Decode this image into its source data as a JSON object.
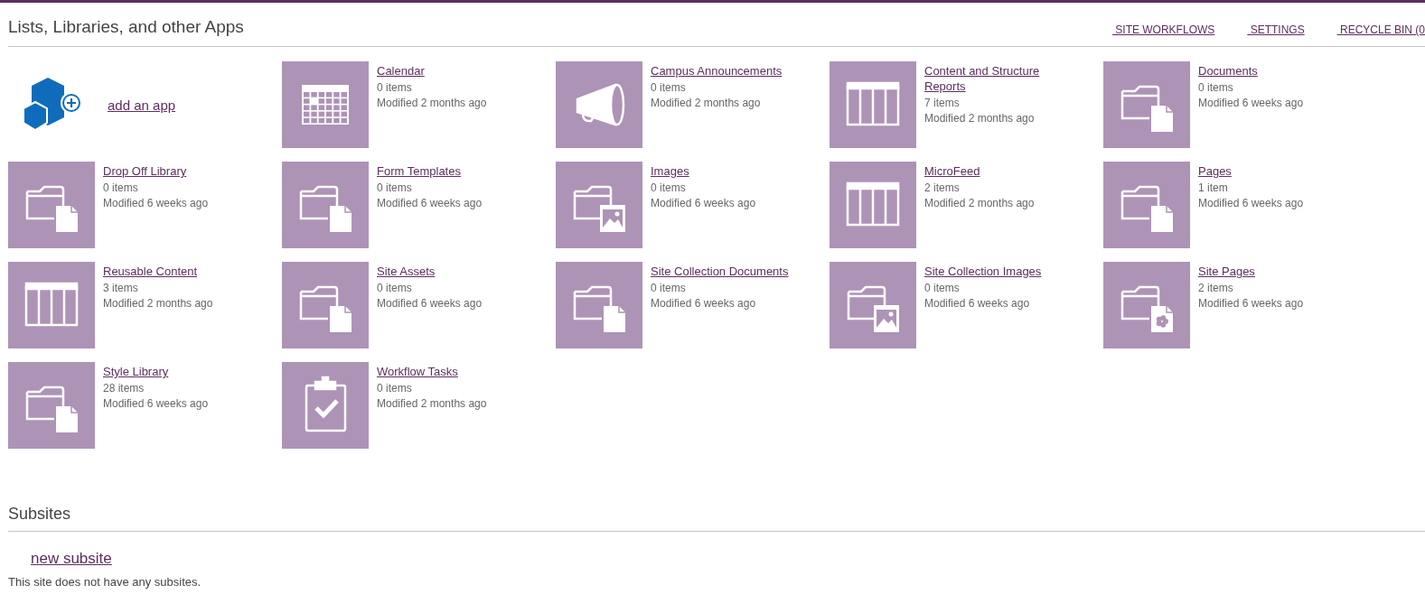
{
  "header": {
    "title": "Lists, Libraries, and other Apps",
    "links": [
      " SITE WORKFLOWS",
      " SETTINGS",
      " RECYCLE BIN (0"
    ]
  },
  "add_app": {
    "label": "add an app"
  },
  "apps": [
    {
      "kind": "calendar",
      "title": "Calendar",
      "count": "0 items",
      "modified": "Modified 2 months ago"
    },
    {
      "kind": "megaphone",
      "title": "Campus Announcements",
      "count": "0 items",
      "modified": "Modified 2 months ago"
    },
    {
      "kind": "table",
      "title": "Content and Structure Reports",
      "count": "7 items",
      "modified": "Modified 2 months ago"
    },
    {
      "kind": "document",
      "title": "Documents",
      "count": "0 items",
      "modified": "Modified 6 weeks ago"
    },
    {
      "kind": "document",
      "title": "Drop Off Library",
      "count": "0 items",
      "modified": "Modified 6 weeks ago"
    },
    {
      "kind": "document",
      "title": "Form Templates",
      "count": "0 items",
      "modified": "Modified 6 weeks ago"
    },
    {
      "kind": "image",
      "title": "Images",
      "count": "0 items",
      "modified": "Modified 6 weeks ago"
    },
    {
      "kind": "table",
      "title": "MicroFeed",
      "count": "2 items",
      "modified": "Modified 2 months ago"
    },
    {
      "kind": "document",
      "title": "Pages",
      "count": "1 item",
      "modified": "Modified 6 weeks ago"
    },
    {
      "kind": "table",
      "title": "Reusable Content",
      "count": "3 items",
      "modified": "Modified 2 months ago"
    },
    {
      "kind": "document",
      "title": "Site Assets",
      "count": "0 items",
      "modified": "Modified 6 weeks ago"
    },
    {
      "kind": "document",
      "title": "Site Collection Documents",
      "count": "0 items",
      "modified": "Modified 6 weeks ago"
    },
    {
      "kind": "image",
      "title": "Site Collection Images",
      "count": "0 items",
      "modified": "Modified 6 weeks ago"
    },
    {
      "kind": "flower",
      "title": "Site Pages",
      "count": "2 items",
      "modified": "Modified 6 weeks ago"
    },
    {
      "kind": "document",
      "title": "Style Library",
      "count": "28 items",
      "modified": "Modified 6 weeks ago"
    },
    {
      "kind": "clipboard",
      "title": "Workflow Tasks",
      "count": "0 items",
      "modified": "Modified 2 months ago"
    }
  ],
  "subsites": {
    "title": "Subsites",
    "new_link": "new subsite",
    "empty_message": "This site does not have any subsites."
  }
}
